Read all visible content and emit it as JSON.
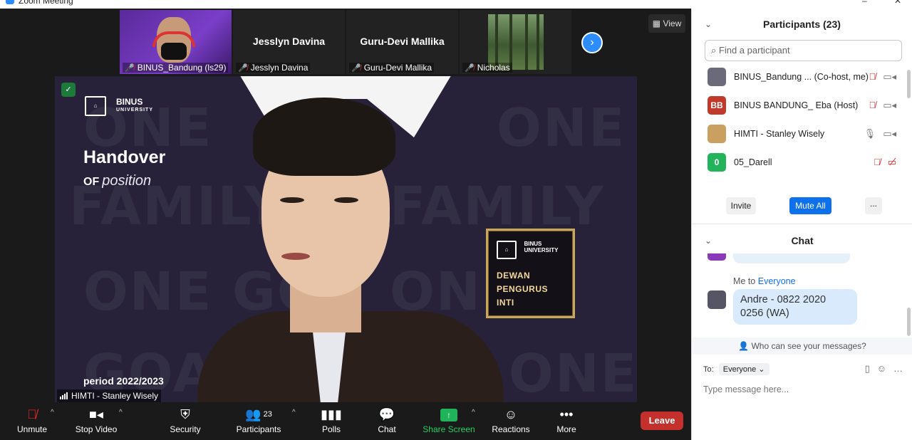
{
  "window": {
    "title": "Zoom Meeting",
    "minimize": "–",
    "close": "✕"
  },
  "thumbnails": [
    {
      "name_display": "",
      "label": "BINUS_Bandung (ls29)",
      "muted": true
    },
    {
      "name_display": "Jesslyn Davina",
      "label": "Jesslyn Davina",
      "muted": true
    },
    {
      "name_display": "Guru-Devi Mallika",
      "label": "Guru-Devi Mallika",
      "muted": true
    },
    {
      "name_display": "",
      "label": "Nicholas",
      "muted": true
    }
  ],
  "view_button": {
    "icon": "▦",
    "label": "View"
  },
  "next_icon": "›",
  "video": {
    "bg_words": [
      "ONE",
      "ONE",
      "FAMILY",
      "FAMILY",
      "ONE GO",
      "ONE",
      "GOA",
      "L ONE"
    ],
    "logo_binus": "BINUS",
    "logo_binus_sub": "UNIVERSITY",
    "heading": "Handover",
    "sub_of": "OF",
    "sub_position": "position",
    "period": "period 2022/2023",
    "card_line1": "DEWAN",
    "card_line2": "PENGURUS",
    "card_line3": "INTI",
    "card_binus": "BINUS",
    "card_binus_sub": "UNIVERSITY",
    "speaker_label": "HIMTI - Stanley Wisely",
    "shield_icon": "✓"
  },
  "toolbar": {
    "unmute": "Unmute",
    "stop_video": "Stop Video",
    "security": "Security",
    "participants": "Participants",
    "participants_count": "23",
    "polls": "Polls",
    "chat": "Chat",
    "share_screen": "Share Screen",
    "reactions": "Reactions",
    "more": "More",
    "leave": "Leave",
    "caret": "^"
  },
  "participants_panel": {
    "title": "Participants (23)",
    "search_placeholder": "Find a participant",
    "rows": [
      {
        "name": "BINUS_Bandung ... (Co-host, me)",
        "avatar_text": "",
        "avatar_color": "#6a6a7a"
      },
      {
        "name": "BINUS BANDUNG_ Eba (Host)",
        "avatar_text": "BB",
        "avatar_color": "#c0392b"
      },
      {
        "name": "HIMTI - Stanley Wisely",
        "avatar_text": "",
        "avatar_color": "#caa060"
      },
      {
        "name": "05_Darell",
        "avatar_text": "0",
        "avatar_color": "#23b35a"
      }
    ],
    "invite": "Invite",
    "mute_all": "Mute All",
    "more": "..."
  },
  "chat_panel": {
    "title": "Chat",
    "msg_meta_prefix": "Me to ",
    "msg_meta_target": "Everyone",
    "message": "Andre - 0822 2020 0256 (WA)",
    "who_can_see": "Who can see your messages?",
    "to_label": "To:",
    "to_target": "Everyone ⌄",
    "input_placeholder": "Type message here..."
  },
  "colors": {
    "accent_blue": "#0e71eb",
    "leave_red": "#c4312d",
    "share_green": "#1fb35a"
  }
}
